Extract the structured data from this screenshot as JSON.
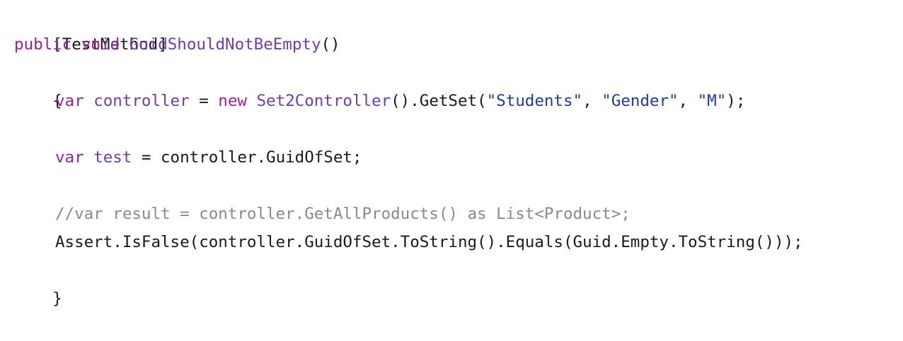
{
  "code": {
    "line1": {
      "text": "[TestMethod]"
    },
    "line2": {
      "kw1": "public",
      "kw2": "void",
      "method": "GuidShouldNotBeEmpty",
      "parens": "()"
    },
    "line3": {
      "text": "{"
    },
    "line4": {
      "kw_var": "var",
      "ident": "controller",
      "eq": " = ",
      "kw_new": "new",
      "type": "Set2Controller",
      "call": "().GetSet(",
      "arg1": "\"Students\"",
      "sep1": ", ",
      "arg2": "\"Gender\"",
      "sep2": ", ",
      "arg3": "\"M\"",
      "end": ");"
    },
    "line6": {
      "kw_var": "var",
      "ident": "test",
      "rest": " = controller.GuidOfSet;"
    },
    "line8": {
      "comment": "//var result = controller.GetAllProducts() as List<Product>;"
    },
    "line9": {
      "text": "Assert.IsFalse(controller.GuidOfSet.ToString().Equals(Guid.Empty.ToString()));"
    },
    "line10": {
      "text": "}"
    }
  },
  "colors": {
    "keyword": "#9b2393",
    "type": "#703daa",
    "string": "#1f3c9a",
    "comment": "#8a8a8a",
    "text": "#1a1a1a",
    "background": "#ffffff"
  }
}
